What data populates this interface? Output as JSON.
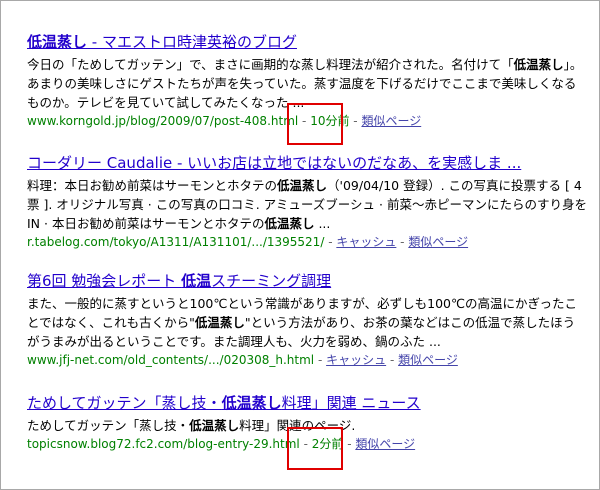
{
  "results": [
    {
      "title_pre": "",
      "title_bold": "低温蒸し",
      "title_post": " - マエストロ時津英裕のブログ",
      "snippet_pre": "今日の「ためしてガッテン」で、まさに画期的な蒸し料理法が紹介された。名付けて「",
      "snippet_bold": "低温蒸し",
      "snippet_post": "」。あまりの美味しさにゲストたちが声を失っていた。蒸す温度を下げるだけでここまで美味しくなるものか。テレビを見ていて試してみたくなった ...",
      "url": "www.korngold.jp/blog/2009/07/post-408.html",
      "time": "10分前",
      "similar": "類似ページ"
    },
    {
      "title_text": "コーダリー Caudalie - いいお店は立地ではないのだなあ、を実感しま ...",
      "snippet_a": "料理：本日お勧め前菜はサーモンとホタテの",
      "snippet_a_bold": "低温蒸し",
      "snippet_b": "（'09/04/10 登録）. この写真に投票する [ 4 票 ]. オリジナル写真 · この写真の口コミ. アミューズブーシュ · 前菜〜赤ピーマンにたらのすり身をIN · 本日お勧め前菜はサーモンとホタテの",
      "snippet_b_bold": "低温蒸し",
      "snippet_c": " ...",
      "url": "r.tabelog.com/tokyo/A1311/A131101/.../1395521/",
      "cache": "キャッシュ",
      "similar": "類似ページ"
    },
    {
      "title_pre": "第6回 勉強会レポート ",
      "title_bold": "低温",
      "title_post": "スチーミング調理",
      "snippet_pre": "また、一般的に蒸すというと100℃という常識がありますが、必ずしも100℃の高温にかぎったことではなく、これも古くから\"",
      "snippet_bold": "低温蒸し",
      "snippet_post": "\"という方法があり、お茶の葉などはこの低温で蒸したほうがうまみが出るということです。また調理人も、火力を弱め、鍋のふた ...",
      "url": "www.jfj-net.com/old_contents/.../020308_h.html",
      "cache": "キャッシュ",
      "similar": "類似ページ"
    },
    {
      "title_pre": "ためしてガッテン「蒸し技・",
      "title_bold": "低温蒸し",
      "title_post": "料理」関連 ニュース",
      "snippet_pre": "ためしてガッテン「蒸し技・",
      "snippet_bold": "低温蒸し",
      "snippet_post": "料理」関連のページ.",
      "url": "topicsnow.blog72.fc2.com/blog-entry-29.html",
      "time": "2分前",
      "similar": "類似ページ"
    }
  ],
  "sep": " - ",
  "highlight_color": "#e00000"
}
